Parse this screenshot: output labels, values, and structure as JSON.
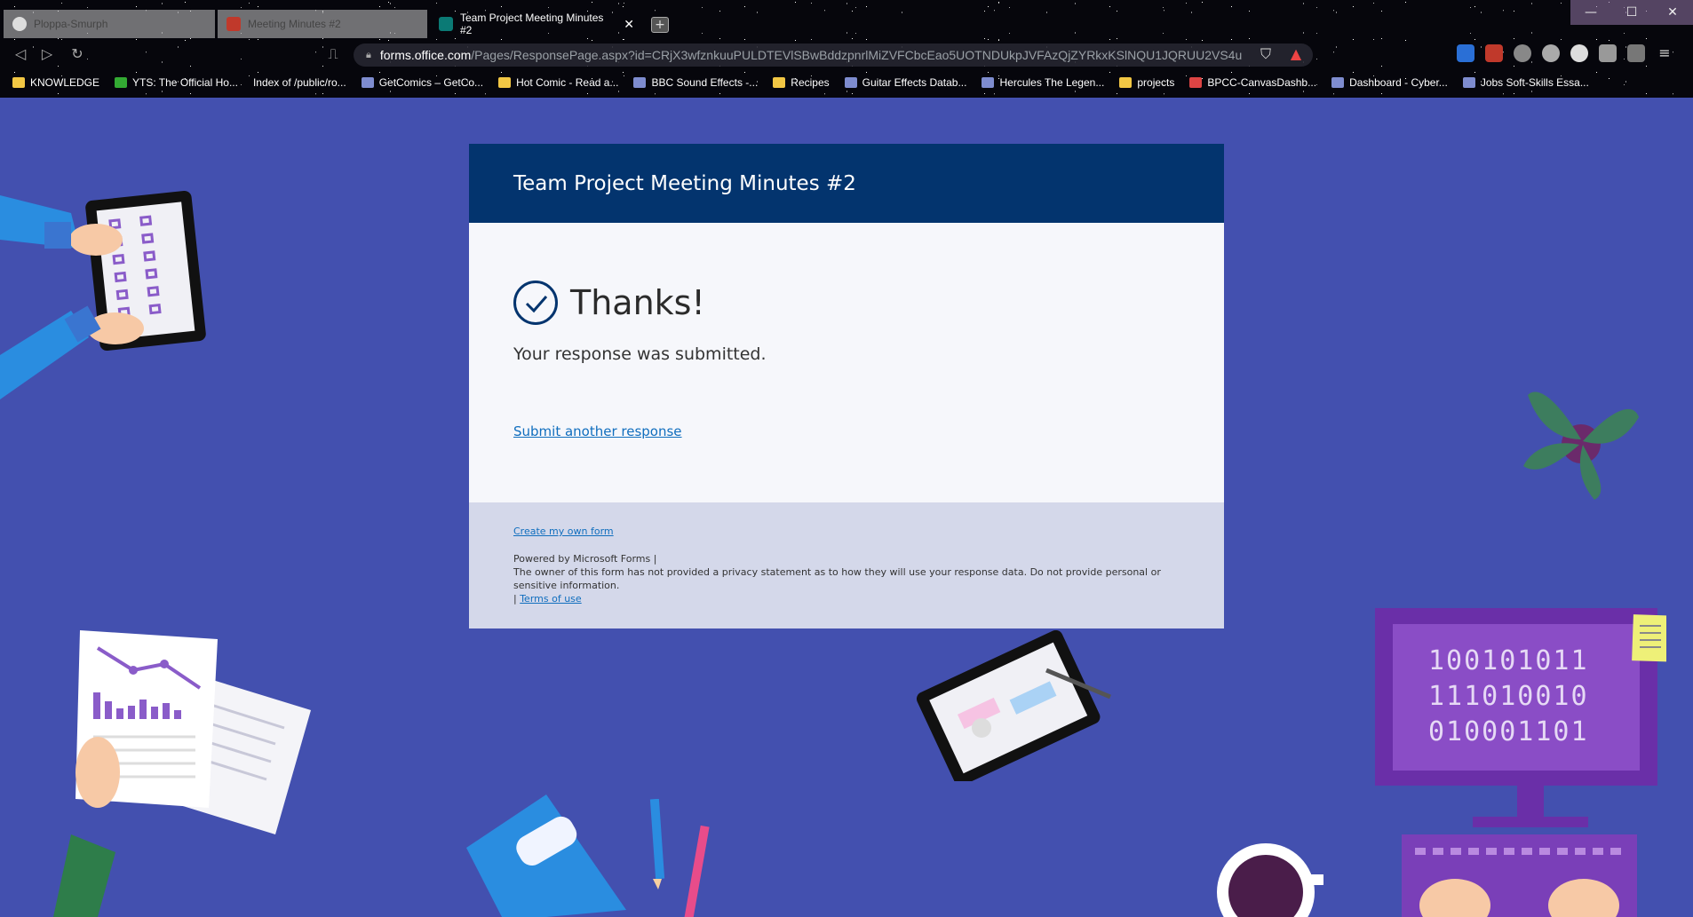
{
  "browser": {
    "tabs": [
      {
        "title": "Ploppa-Smurph",
        "icon": "github-icon",
        "active": false
      },
      {
        "title": "Meeting Minutes #2",
        "icon": "canvas-icon",
        "active": false
      },
      {
        "title": "Team Project Meeting Minutes #2",
        "icon": "forms-icon",
        "active": true
      }
    ],
    "new_tab_label": "+",
    "window_buttons": {
      "minimize": "—",
      "maximize": "☐",
      "close": "✕"
    },
    "url": {
      "host": "forms.office.com",
      "path": "/Pages/ResponsePage.aspx?id=CRjX3wfznkuuPULDTEVlSBwBddzpnrlMiZVFCbcEao5UOTNDUkpJVFAzQjZYRkxKSlNQU1JQRUU2VS4u"
    },
    "bookmarks": [
      {
        "label": "KNOWLEDGE",
        "icon": "folder"
      },
      {
        "label": "YTS: The Official Ho...",
        "icon": "green"
      },
      {
        "label": "Index of /public/ro...",
        "icon": "none"
      },
      {
        "label": "GetComics – GetCo...",
        "icon": "site"
      },
      {
        "label": "Hot Comic - Read a...",
        "icon": "folder"
      },
      {
        "label": "BBC Sound Effects -...",
        "icon": "site"
      },
      {
        "label": "Recipes",
        "icon": "folder"
      },
      {
        "label": "Guitar Effects Datab...",
        "icon": "site"
      },
      {
        "label": "Hercules The Legen...",
        "icon": "site"
      },
      {
        "label": "projects",
        "icon": "folder"
      },
      {
        "label": "BPCC-CanvasDashb...",
        "icon": "red"
      },
      {
        "label": "Dashboard - Cyber...",
        "icon": "site"
      },
      {
        "label": "Jobs Soft-Skills Essa...",
        "icon": "site"
      }
    ]
  },
  "form": {
    "title": "Team Project Meeting Minutes #2",
    "thanks": "Thanks!",
    "submitted": "Your response was submitted.",
    "another": "Submit another response"
  },
  "footer": {
    "create": "Create my own form",
    "powered": "Powered by Microsoft Forms |",
    "privacy": "The owner of this form has not provided a privacy statement as to how they will use your response data. Do not provide personal or sensitive information.",
    "terms_prefix": "| ",
    "terms": "Terms of use"
  },
  "monitor": {
    "lines": [
      "100101011",
      "111010010",
      "010001101"
    ]
  },
  "colors": {
    "page_bg": "#4350af",
    "header_bg": "#03346e",
    "footer_bg": "#d4d8ea",
    "link": "#106ebe"
  }
}
